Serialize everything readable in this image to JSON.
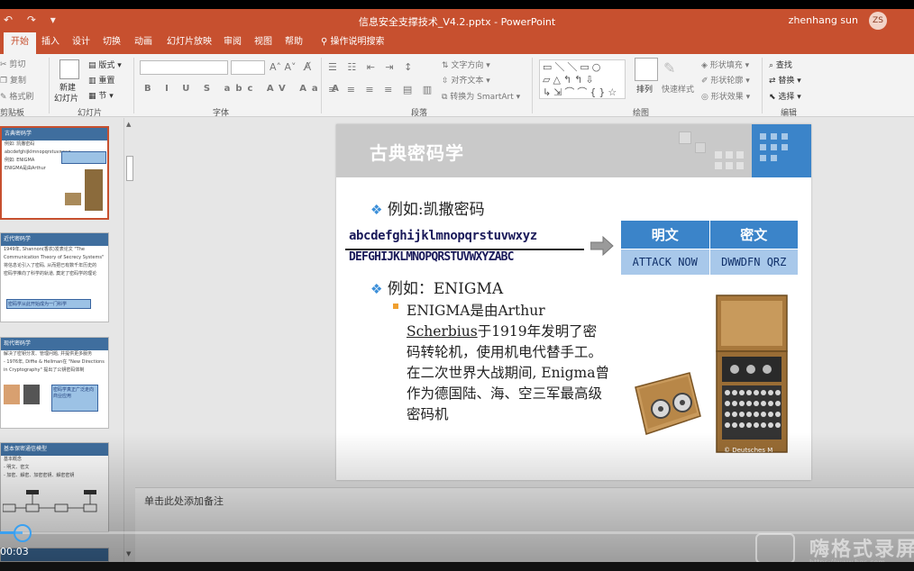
{
  "window": {
    "title": "信息安全支撑技术_V4.2.pptx - PowerPoint",
    "user": "zhenhang sun",
    "avatar_initials": "ZS"
  },
  "qat_icons": [
    "undo-icon",
    "redo-icon",
    "customize-icon"
  ],
  "tabs": [
    "开始",
    "插入",
    "设计",
    "切换",
    "动画",
    "幻灯片放映",
    "审阅",
    "视图",
    "帮助",
    "操作说明搜索"
  ],
  "ribbon": {
    "clipboard": {
      "cut": "剪切",
      "copy": "复制",
      "format_painter": "格式刷",
      "label": "剪贴板"
    },
    "slides": {
      "new_slide": "新建\n幻灯片",
      "new_slide_l1": "新建",
      "new_slide_l2": "幻灯片",
      "layout": "版式",
      "reset": "重置",
      "section": "节",
      "label": "幻灯片"
    },
    "font": {
      "label": "字体",
      "buttons": [
        "B",
        "I",
        "U",
        "S",
        "abc",
        "AV",
        "Aa",
        "A"
      ]
    },
    "paragraph": {
      "label": "段落",
      "text_direction": "文字方向",
      "align_text": "对齐文本",
      "smartart": "转换为 SmartArt"
    },
    "drawing": {
      "label": "绘图",
      "arrange": "排列",
      "quick_styles": "快速样式",
      "shape_fill": "形状填充",
      "shape_outline": "形状轮廓",
      "shape_effects": "形状效果"
    },
    "editing": {
      "label": "编辑",
      "find": "查找",
      "replace": "替换",
      "select": "选择"
    }
  },
  "slide": {
    "title": "古典密码学",
    "example1": "例如:凯撒密码",
    "plain_alphabet": "abcdefghijklmnopqrstuvwxyz",
    "cipher_alphabet": "DEFGHIJKLMNOPQRSTUVWXYZABC",
    "table": {
      "headers": [
        "明文",
        "密文"
      ],
      "row": [
        "ATTACK NOW",
        "DWWDFN QRZ"
      ]
    },
    "example2": "例如：ENIGMA",
    "enigma_text_a": "ENIGMA是由Arthur",
    "enigma_text_b": "Scherbius",
    "enigma_text_c": "于1919年发明了密码转轮机，使用机电代替手工。在二次世界大战期间, Enigma曾作为德国陆、海、空三军最高级密码机",
    "image_caption": "© Deutsches M"
  },
  "thumbnails": [
    {
      "title": "古典密码学",
      "lines": [
        "例如: 凯撒密码",
        "abcdefghijklmnopqrstuvwxyz",
        "例如: ENIGMA",
        "ENIGMA是由Arthur"
      ]
    },
    {
      "title": "近代密码学",
      "lines": [
        "1949年, Shannon(香农)发表论文 \"The",
        "Communication Theory of Secrecy Systems\"",
        "将信息论引入了密码, 从而把已有数千年历史的",
        "密码学推向了科学的轨道, 奠定了密码学的理论"
      ],
      "box": "密码学从此开始成为一门科学"
    },
    {
      "title": "现代密码学",
      "lines": [
        "解决了密钥分发、管理问题, 并提供更多服务",
        "- 1976年, Diffie & Hellman在 \"New Directions",
        "in Cryptography\" 提出了公钥密码体制"
      ],
      "box": "密码学真正广泛走向商业应用"
    },
    {
      "title": "基本保密通信模型",
      "lines": [
        "基本概念",
        "- 明文、密文",
        "- 加密、解密、加密密钥、解密密钥"
      ]
    }
  ],
  "notes_placeholder": "单击此处添加备注",
  "video": {
    "time": "00:03",
    "progress_fraction": 0.025,
    "watermark": "嗨格式录屏",
    "watermark_url": "https://www.hgs.com"
  },
  "colors": {
    "accent": "#c7502f",
    "slide_blue": "#3b84c9",
    "table_light": "#a8c8ea"
  }
}
